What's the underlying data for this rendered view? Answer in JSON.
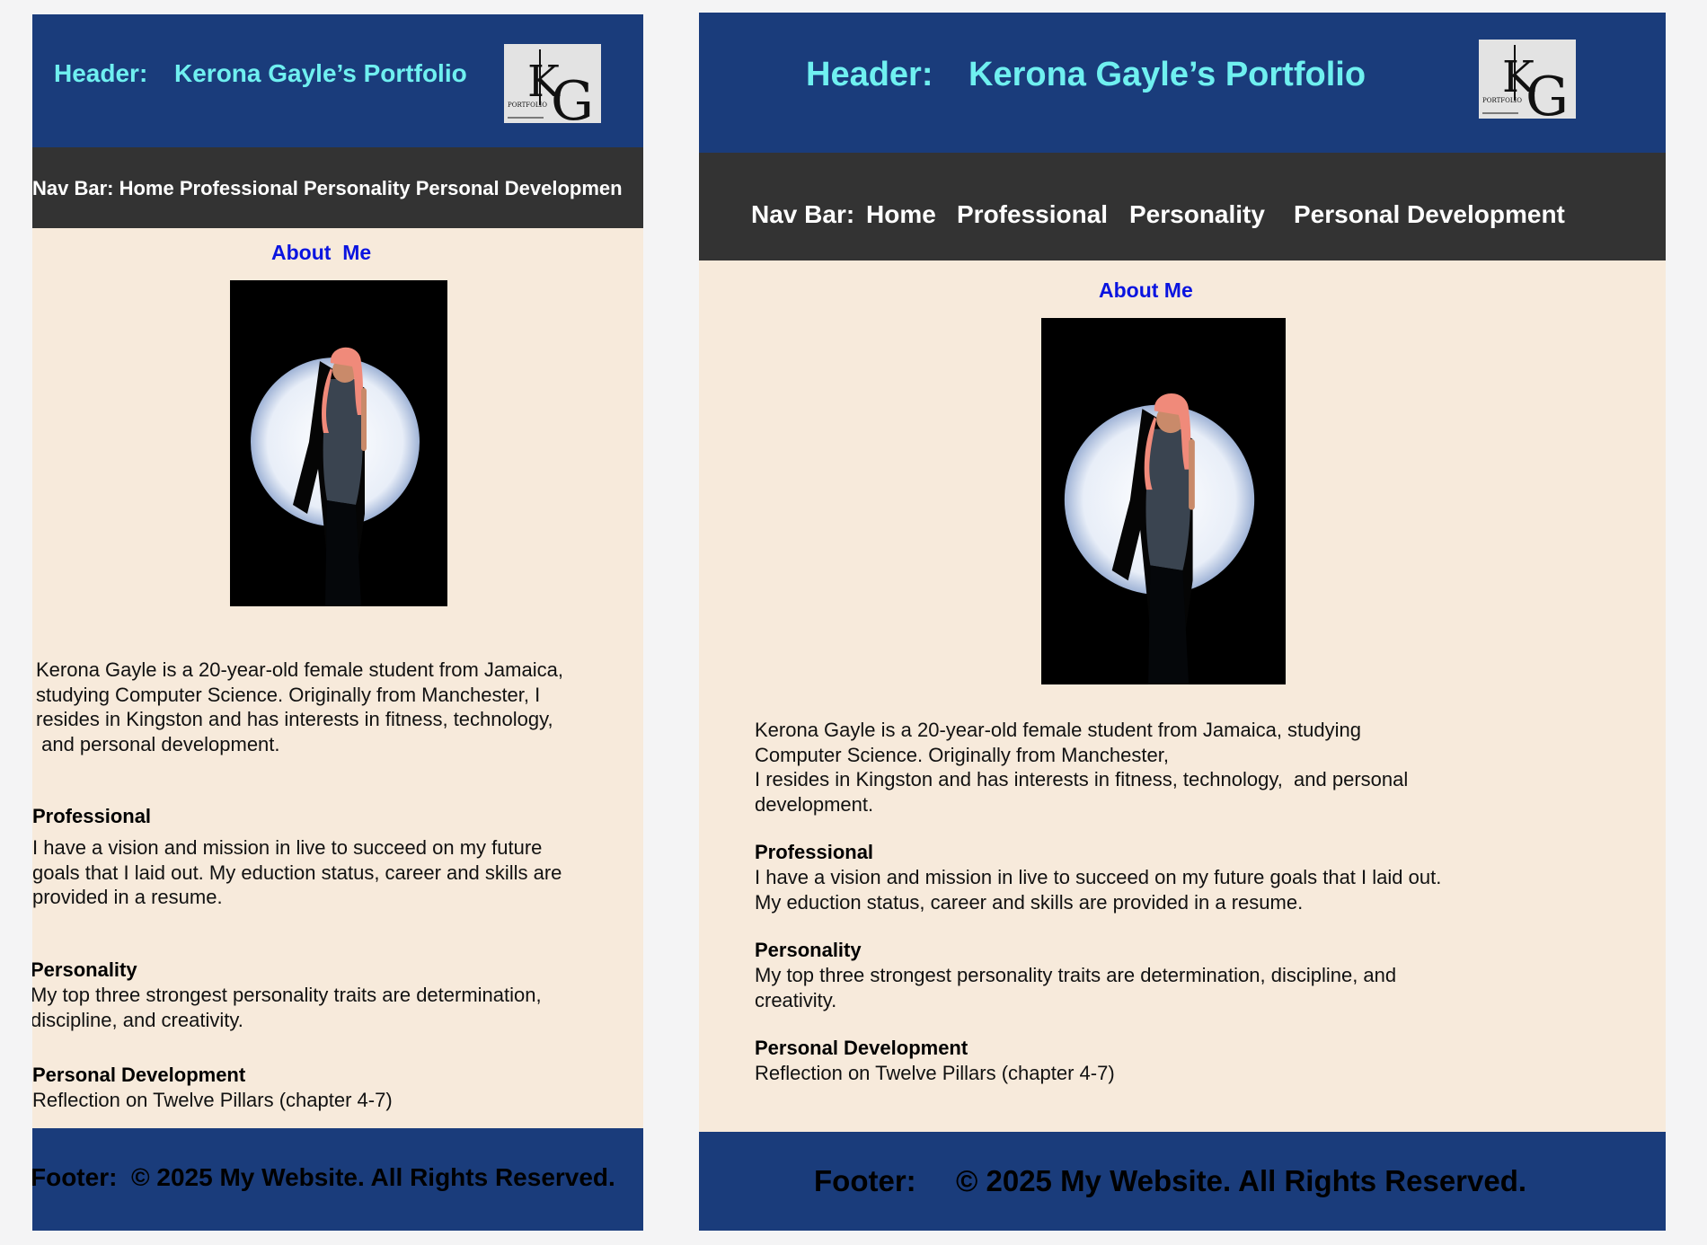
{
  "colors": {
    "page_bg": "#f4f4f5",
    "header_bg": "#1a3c7b",
    "header_text": "#6ff0f0",
    "nav_bg": "#333333",
    "nav_text": "#ffffff",
    "content_bg": "#f7eadb",
    "about_link": "#0a14e0",
    "body_text": "#111111"
  },
  "header": {
    "label": "Header:",
    "title": "Kerona Gayle’s Portfolio",
    "logo": {
      "monogram_k": "K",
      "monogram_g": "G",
      "caption": "PORTFOLIO",
      "icon": "kg-portfolio-logo"
    }
  },
  "nav": {
    "mobile_text": "Nav Bar: Home Professional Personality Personal Developmen",
    "label": "Nav Bar:",
    "items": [
      "Home",
      "Professional",
      "Personality",
      "Personal Development"
    ]
  },
  "about": {
    "mobile_label": "About  Me",
    "desktop_label": "About Me"
  },
  "photo": {
    "icon": "profile-photo-spotlight"
  },
  "intro": {
    "mobile_lines": [
      "Kerona Gayle is a 20-year-old female student from Jamaica,",
      "studying Computer Science. Originally from Manchester, I",
      "resides in Kingston and has interests in fitness, technology,",
      " and personal development."
    ],
    "desktop_lines": [
      "Kerona Gayle is a 20-year-old female student from Jamaica, studying",
      "Computer Science. Originally from Manchester,",
      "I resides in Kingston and has interests in fitness, technology,  and personal",
      "development."
    ]
  },
  "professional": {
    "title": "Professional",
    "mobile_lines": [
      "I have a vision and mission in live to succeed on my future",
      "goals that I laid out. My eduction status, career and skills are",
      "provided in a resume."
    ],
    "desktop_lines": [
      "I have a vision and mission in live to succeed on my future goals that I laid out.",
      "My eduction status, career and skills are provided in a resume."
    ]
  },
  "personality": {
    "title": "Personality",
    "mobile_lines": [
      "My top three strongest personality traits are determination,",
      "discipline, and creativity."
    ],
    "desktop_lines": [
      "My top three strongest personality traits are determination, discipline, and",
      "creativity."
    ]
  },
  "personal_development": {
    "title": "Personal Development",
    "text": "Reflection on Twelve Pillars (chapter 4-7)"
  },
  "footer": {
    "mobile_text": "Footer:  © 2025 My Website. All Rights Reserved.",
    "label": "Footer:",
    "copyright": "© 2025 My Website. All Rights Reserved."
  }
}
